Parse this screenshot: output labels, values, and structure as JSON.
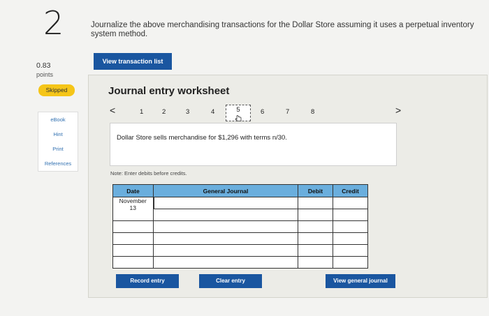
{
  "question": {
    "number": "2",
    "text": "Journalize the above merchandising transactions for the Dollar Store assuming it uses a perpetual inventory system method.",
    "points_value": "0.83",
    "points_label": "points",
    "status_badge": "Skipped"
  },
  "sidebar": {
    "links": [
      "eBook",
      "Hint",
      "Print",
      "References"
    ]
  },
  "actions": {
    "view_transaction_list": "View transaction list",
    "record_entry": "Record entry",
    "clear_entry": "Clear entry",
    "view_general_journal": "View general journal"
  },
  "worksheet": {
    "title": "Journal entry worksheet",
    "prev_arrow": "<",
    "next_arrow": ">",
    "pages": [
      "1",
      "2",
      "3",
      "4",
      "5",
      "6",
      "7",
      "8"
    ],
    "active_page": "5",
    "description": "Dollar Store sells merchandise for $1,296 with terms n/30.",
    "note": "Note: Enter debits before credits.",
    "table": {
      "headers": [
        "Date",
        "General Journal",
        "Debit",
        "Credit"
      ],
      "date_month": "November",
      "date_day": "13"
    }
  }
}
